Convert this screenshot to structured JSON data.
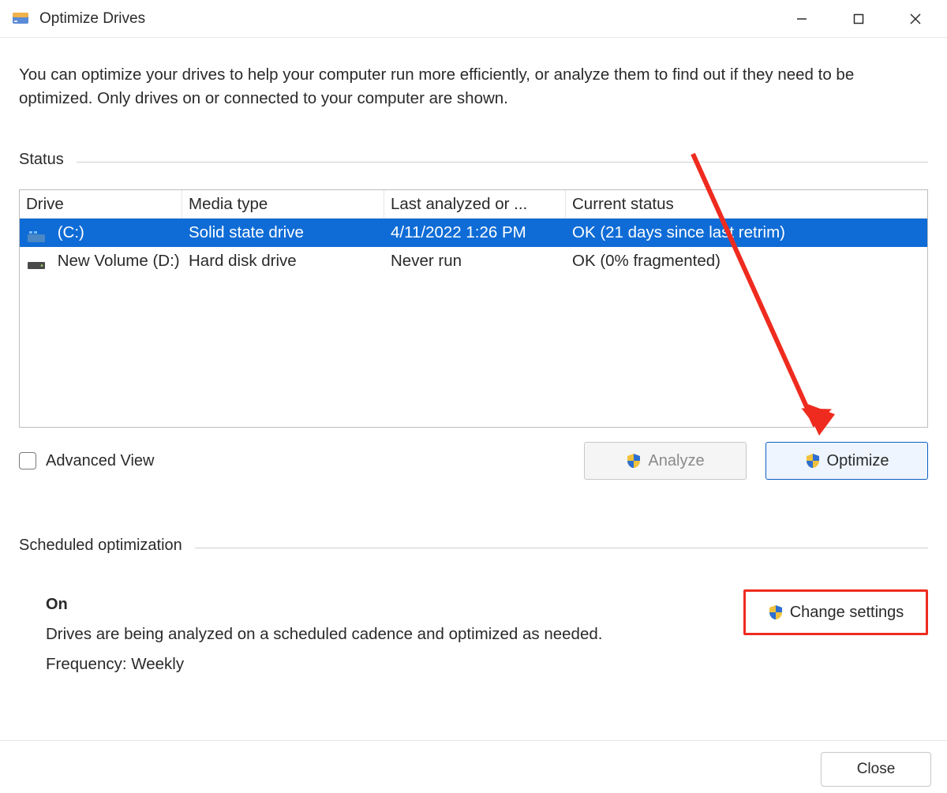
{
  "window": {
    "title": "Optimize Drives"
  },
  "intro_text": "You can optimize your drives to help your computer run more efficiently, or analyze them to find out if they need to be optimized. Only drives on or connected to your computer are shown.",
  "status": {
    "label": "Status",
    "columns": {
      "drive": "Drive",
      "media": "Media type",
      "last": "Last analyzed or ...",
      "status": "Current status"
    },
    "rows": [
      {
        "name": "(C:)",
        "icon": "ssd-drive-icon",
        "media": "Solid state drive",
        "last": "4/11/2022 1:26 PM",
        "status": "OK (21 days since last retrim)",
        "selected": true
      },
      {
        "name": "New Volume (D:)",
        "icon": "hdd-drive-icon",
        "media": "Hard disk drive",
        "last": "Never run",
        "status": "OK (0% fragmented)",
        "selected": false
      }
    ]
  },
  "advanced_view_label": "Advanced View",
  "buttons": {
    "analyze": "Analyze",
    "optimize": "Optimize"
  },
  "scheduled": {
    "label": "Scheduled optimization",
    "state": "On",
    "desc": "Drives are being analyzed on a scheduled cadence and optimized as needed.",
    "frequency": "Frequency: Weekly",
    "change": "Change settings"
  },
  "footer": {
    "close": "Close"
  }
}
